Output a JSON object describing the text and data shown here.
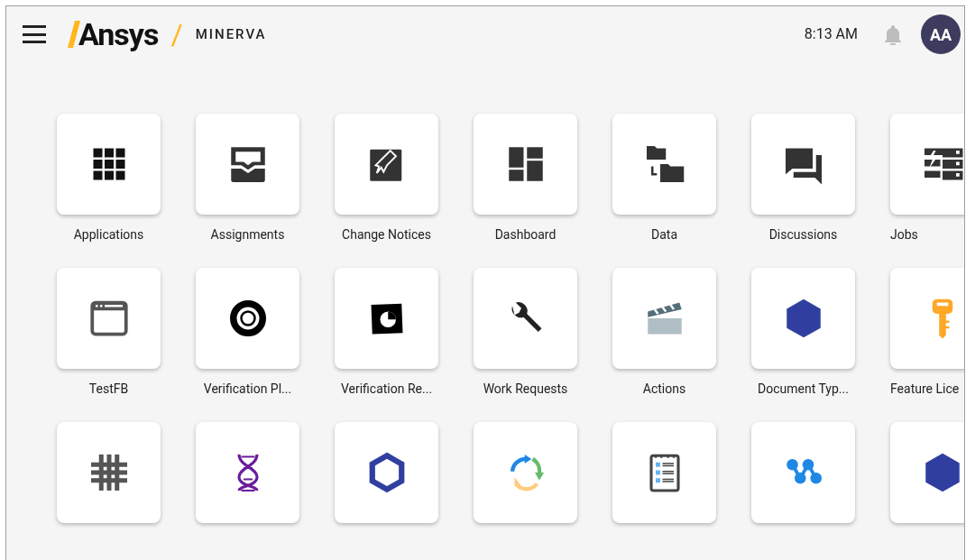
{
  "header": {
    "logo": "Ansys",
    "separator": "/",
    "product": "MINERVA",
    "time": "8:13 AM",
    "avatar": "AA"
  },
  "tile_rows": [
    [
      {
        "kind": "apps",
        "label": "Applications"
      },
      {
        "kind": "inbox",
        "label": "Assignments"
      },
      {
        "kind": "notice",
        "label": "Change Notices"
      },
      {
        "kind": "dashboard",
        "label": "Dashboard"
      },
      {
        "kind": "folders",
        "label": "Data"
      },
      {
        "kind": "chat",
        "label": "Discussions"
      },
      {
        "kind": "server",
        "label": "Jobs"
      }
    ],
    [
      {
        "kind": "window",
        "label": "TestFB"
      },
      {
        "kind": "target",
        "label": "Verification Pl..."
      },
      {
        "kind": "report",
        "label": "Verification Re..."
      },
      {
        "kind": "wrench",
        "label": "Work Requests"
      },
      {
        "kind": "clapper",
        "label": "Actions"
      },
      {
        "kind": "hexagon",
        "label": "Document Typ..."
      },
      {
        "kind": "key",
        "label": "Feature Lice"
      }
    ],
    [
      {
        "kind": "hashgrid"
      },
      {
        "kind": "dna"
      },
      {
        "kind": "hexring"
      },
      {
        "kind": "cycle"
      },
      {
        "kind": "checklist"
      },
      {
        "kind": "network"
      },
      {
        "kind": "hexagon"
      }
    ]
  ]
}
